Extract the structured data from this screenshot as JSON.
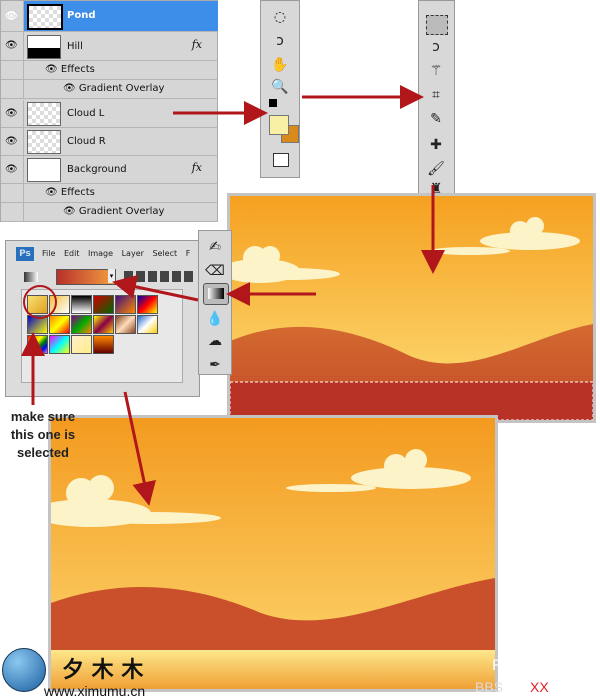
{
  "layers_panel": {
    "layers": [
      {
        "name": "Pond",
        "selected": true
      },
      {
        "name": "Hill",
        "fx": "fx",
        "effects_label": "Effects",
        "effect": "Gradient Overlay"
      },
      {
        "name": "Cloud L"
      },
      {
        "name": "Cloud R"
      },
      {
        "name": "Background",
        "fx": "fx",
        "effects_label": "Effects",
        "effect": "Gradient Overlay"
      }
    ]
  },
  "photoshop": {
    "logo": "Ps",
    "menu": [
      "File",
      "Edit",
      "Image",
      "Layer",
      "Select",
      "F"
    ]
  },
  "annotation": {
    "note": "make sure this one is selected"
  },
  "colors": {
    "arrow": "#b0161a",
    "selection": "#3d8ee8",
    "sky_top": "#f39a1f",
    "sky_bottom": "#fde07a",
    "hill": "#c9502a"
  },
  "watermark": {
    "chinese": "夕 木 木",
    "url": "www.ximumu.cn",
    "bbs": "BBS",
    "xx": "XX",
    "p": "P"
  }
}
